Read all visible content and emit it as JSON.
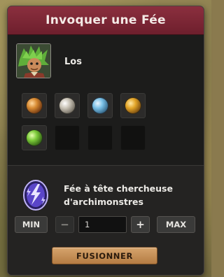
{
  "dialog": {
    "title": "Invoquer une Fée"
  },
  "summoner": {
    "name": "Los",
    "portrait_icon": "green-haired-character-portrait-icon"
  },
  "resource_slots": [
    {
      "filled": true,
      "icon": "orange-orb-icon"
    },
    {
      "filled": true,
      "icon": "silver-orb-icon"
    },
    {
      "filled": true,
      "icon": "blue-orb-icon"
    },
    {
      "filled": true,
      "icon": "gold-orb-icon"
    },
    {
      "filled": true,
      "icon": "green-orb-icon"
    },
    {
      "filled": false
    },
    {
      "filled": false
    },
    {
      "filled": false
    }
  ],
  "result_item": {
    "name": "Fée à tête chercheuse d'archimonstres",
    "icon": "purple-lightning-crystal-icon"
  },
  "quantity": {
    "min_label": "MIN",
    "minus_label": "−",
    "value": "1",
    "plus_label": "+",
    "max_label": "MAX"
  },
  "actions": {
    "fuse_label": "FUSIONNER"
  },
  "colors": {
    "title_bar": "#7a2635",
    "panel": "#232221",
    "fuse_button": "#c68f56"
  }
}
